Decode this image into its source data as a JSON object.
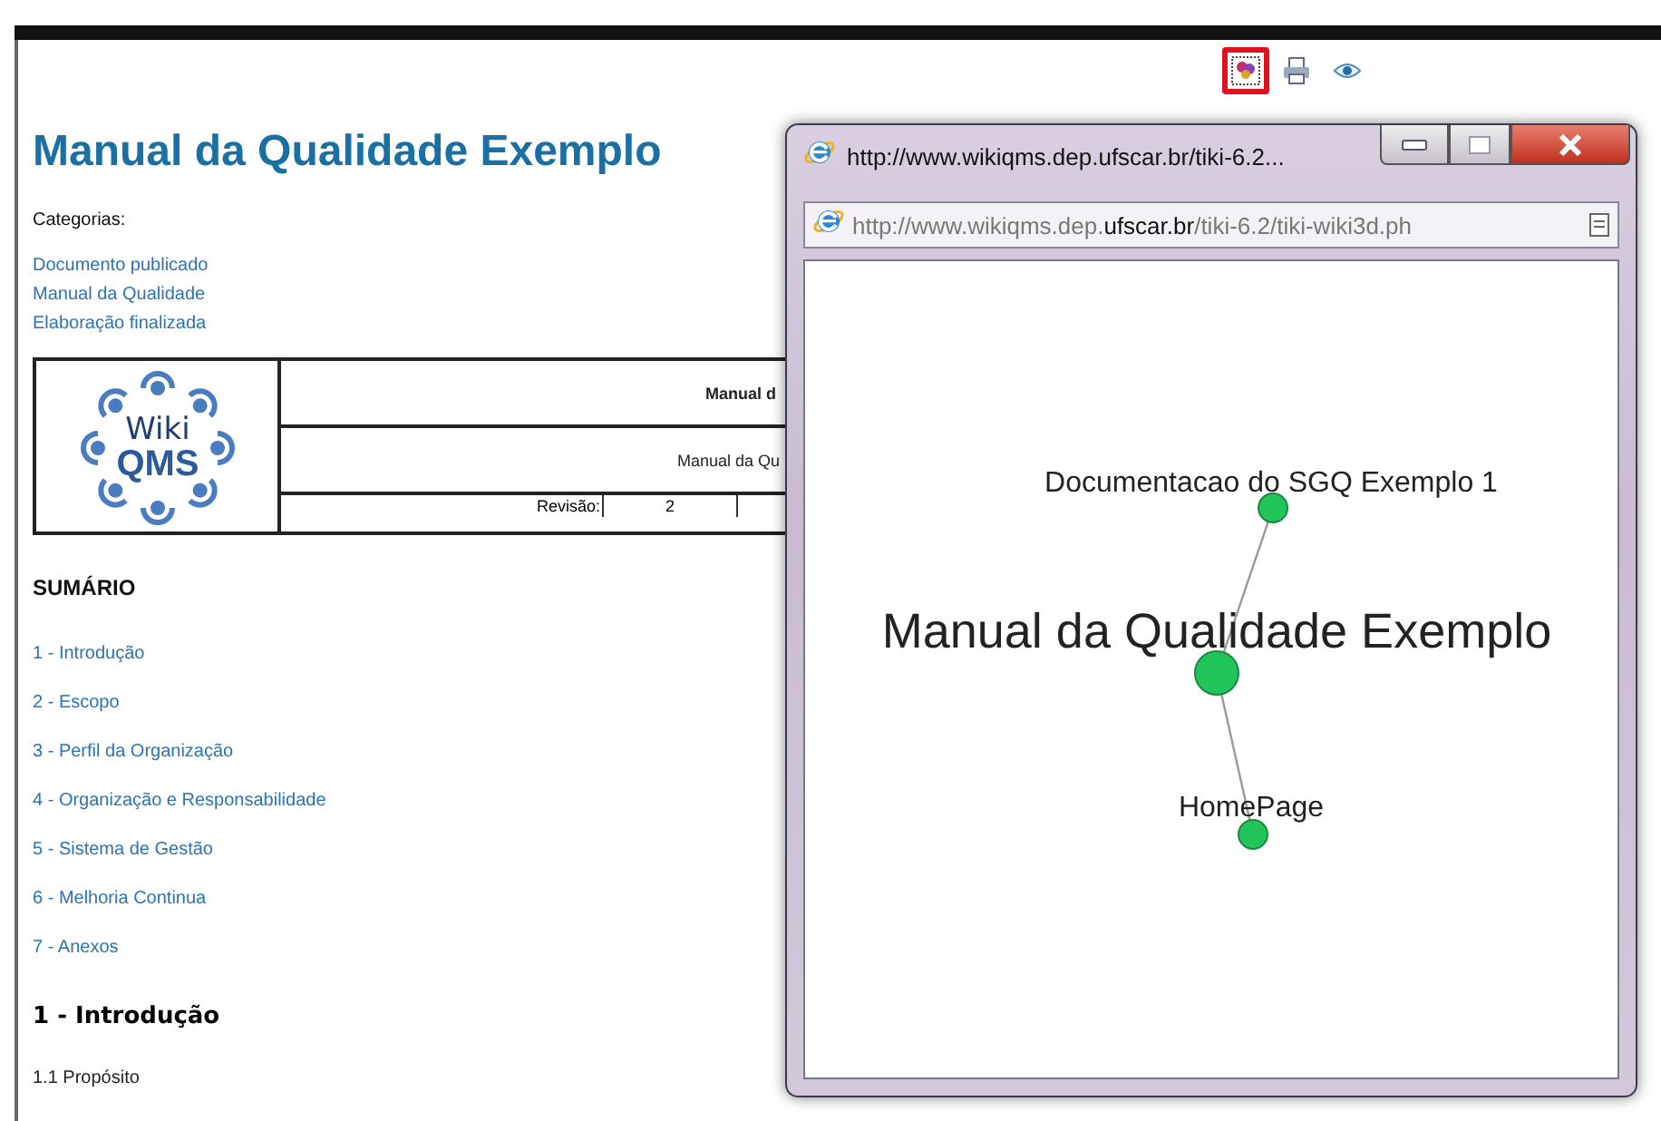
{
  "toolbar": {
    "icons": [
      {
        "kind": "wiki3d",
        "selected": true
      },
      {
        "kind": "print",
        "selected": false
      },
      {
        "kind": "view",
        "selected": false
      }
    ]
  },
  "page": {
    "title": "Manual da Qualidade Exemplo",
    "categories_label": "Categorias:",
    "categories": [
      "Documento publicado",
      "Manual da Qualidade",
      "Elaboração finalizada"
    ],
    "header_table": {
      "logo": {
        "top": "Wiki",
        "bottom": "QMS"
      },
      "row_1": "Manual d",
      "row_2": "Manual da Qu",
      "revision_label": "Revisão:",
      "revision_value": "2"
    },
    "summary_title": "SUMÁRIO",
    "summary": [
      "1 - Introdução",
      "2 - Escopo",
      "3 - Perfil da Organização",
      "4 - Organização e Responsabilidade",
      "5 - Sistema de Gestão",
      "6 - Melhoria Continua",
      "7 - Anexos"
    ],
    "section_heading": "1 - Introdução",
    "subsection": "1.1 Propósito"
  },
  "popup": {
    "title": "http://www.wikiqms.dep.ufscar.br/tiki-6.2...",
    "address": "http://www.wikiqms.dep.**ufscar.br**/tiki-6.2/tiki-wiki3d.ph",
    "graph": {
      "nodes": [
        {
          "label": "Documentacao do SGQ Exemplo 1",
          "kind": "neighbor"
        },
        {
          "label": "Manual da Qualidade Exemplo",
          "kind": "center"
        },
        {
          "label": "HomePage",
          "kind": "neighbor"
        }
      ]
    }
  }
}
